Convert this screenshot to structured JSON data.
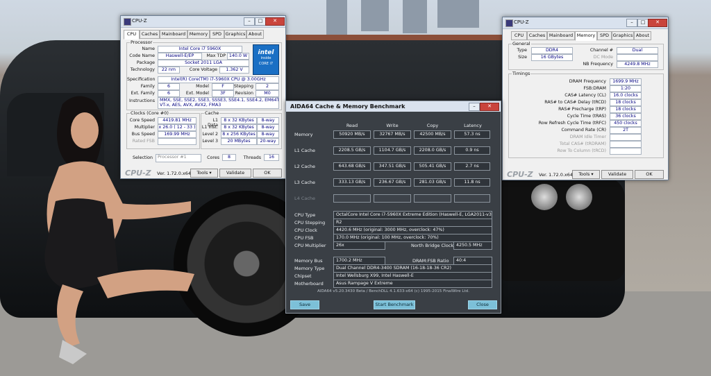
{
  "cpuz_left": {
    "title": "CPU-Z",
    "tabs": [
      "CPU",
      "Caches",
      "Mainboard",
      "Memory",
      "SPD",
      "Graphics",
      "About"
    ],
    "processor": {
      "group": "Processor",
      "name_label": "Name",
      "name": "Intel Core i7 5960X",
      "codename_label": "Code Name",
      "codename": "Haswell-E/EP",
      "tdp_label": "Max TDP",
      "tdp": "140.0 W",
      "package_label": "Package",
      "package": "Socket 2011 LGA",
      "technology_label": "Technology",
      "technology": "22 nm",
      "voltage_label": "Core Voltage",
      "voltage": "1.362 V",
      "spec_label": "Specification",
      "spec": "Intel(R) Core(TM) i7-5960X CPU @ 3.00GHz",
      "family_label": "Family",
      "family": "6",
      "model_label": "Model",
      "model": "F",
      "stepping_label": "Stepping",
      "stepping": "2",
      "extfamily_label": "Ext. Family",
      "extfamily": "6",
      "extmodel_label": "Ext. Model",
      "extmodel": "3F",
      "revision_label": "Revision",
      "revision": "M0",
      "instructions_label": "Instructions",
      "instructions_1": "MMX, SSE, SSE2, SSE3, SSSE3, SSE4.1, SSE4.2, EM64T,",
      "instructions_2": "VT-x, AES, AVX, AVX2, FMA3",
      "logo_1": "intel",
      "logo_2": "inside",
      "logo_3": "CORE i7"
    },
    "clocks": {
      "group": "Clocks (Core #0)",
      "core_speed_label": "Core Speed",
      "core_speed": "4419.81 MHz",
      "multiplier_label": "Multiplier",
      "multiplier": "x 26.0 ( 12 - 33 )",
      "bus_speed_label": "Bus Speed",
      "bus_speed": "169.99 MHz",
      "rated_fsb_label": "Rated FSB",
      "rated_fsb": ""
    },
    "cache": {
      "group": "Cache",
      "l1d_label": "L1 Data",
      "l1d": "8 x 32 KBytes",
      "l1d_way": "8-way",
      "l1i_label": "L1 Inst.",
      "l1i": "8 x 32 KBytes",
      "l1i_way": "8-way",
      "l2_label": "Level 2",
      "l2": "8 x 256 KBytes",
      "l2_way": "8-way",
      "l3_label": "Level 3",
      "l3": "20 MBytes",
      "l3_way": "20-way"
    },
    "selection_label": "Selection",
    "selection": "Processor #1",
    "cores_label": "Cores",
    "cores": "8",
    "threads_label": "Threads",
    "threads": "16",
    "brand": "CPU-Z",
    "version": "Ver. 1.72.0.x64",
    "tools": "Tools",
    "validate": "Validate",
    "ok": "OK"
  },
  "cpuz_right": {
    "title": "CPU-Z",
    "tabs": [
      "CPU",
      "Caches",
      "Mainboard",
      "Memory",
      "SPD",
      "Graphics",
      "About"
    ],
    "general": {
      "group": "General",
      "type_label": "Type",
      "type": "DDR4",
      "channel_label": "Channel #",
      "channel": "Dual",
      "size_label": "Size",
      "size": "16 GBytes",
      "dcmode_label": "DC Mode",
      "dcmode": "",
      "nbfreq_label": "NB Frequency",
      "nbfreq": "4249.8 MHz"
    },
    "timings": {
      "group": "Timings",
      "rows": [
        {
          "label": "DRAM Frequency",
          "value": "1699.9 MHz",
          "dim": false
        },
        {
          "label": "FSB:DRAM",
          "value": "1:20",
          "dim": false
        },
        {
          "label": "CAS# Latency (CL)",
          "value": "16.0 clocks",
          "dim": false
        },
        {
          "label": "RAS# to CAS# Delay (tRCD)",
          "value": "18 clocks",
          "dim": false
        },
        {
          "label": "RAS# Precharge (tRP)",
          "value": "18 clocks",
          "dim": false
        },
        {
          "label": "Cycle Time (tRAS)",
          "value": "36 clocks",
          "dim": false
        },
        {
          "label": "Row Refresh Cycle Time (tRFC)",
          "value": "450 clocks",
          "dim": false
        },
        {
          "label": "Command Rate (CR)",
          "value": "2T",
          "dim": false
        },
        {
          "label": "DRAM Idle Timer",
          "value": "",
          "dim": true
        },
        {
          "label": "Total CAS# (tRDRAM)",
          "value": "",
          "dim": true
        },
        {
          "label": "Row To Column (tRCD)",
          "value": "",
          "dim": true
        }
      ]
    },
    "brand": "CPU-Z",
    "version": "Ver. 1.72.0.x64",
    "tools": "Tools",
    "validate": "Validate",
    "ok": "OK"
  },
  "aida": {
    "title": "AIDA64 Cache & Memory Benchmark",
    "columns": [
      "Read",
      "Write",
      "Copy",
      "Latency"
    ],
    "rows": [
      {
        "label": "Memory",
        "read": "50920 MB/s",
        "write": "32767 MB/s",
        "copy": "42500 MB/s",
        "latency": "57.3 ns"
      },
      {
        "label": "L1 Cache",
        "read": "2208.5 GB/s",
        "write": "1104.7 GB/s",
        "copy": "2208.0 GB/s",
        "latency": "0.9 ns"
      },
      {
        "label": "L2 Cache",
        "read": "643.68 GB/s",
        "write": "347.51 GB/s",
        "copy": "505.41 GB/s",
        "latency": "2.7 ns"
      },
      {
        "label": "L3 Cache",
        "read": "333.13 GB/s",
        "write": "236.67 GB/s",
        "copy": "281.03 GB/s",
        "latency": "11.8 ns"
      },
      {
        "label": "L4 Cache",
        "read": "",
        "write": "",
        "copy": "",
        "latency": ""
      }
    ],
    "info": {
      "cpu_type_label": "CPU Type",
      "cpu_type": "OctalCore Intel Core i7-5960X Extreme Edition  (Haswell-E, LGA2011-v3)",
      "cpu_stepping_label": "CPU Stepping",
      "cpu_stepping": "R2",
      "cpu_clock_label": "CPU Clock",
      "cpu_clock": "4420.6 MHz  (original: 3000 MHz, overclock: 47%)",
      "cpu_fsb_label": "CPU FSB",
      "cpu_fsb": "170.0 MHz  (original: 100 MHz, overclock: 70%)",
      "cpu_mult_label": "CPU Multiplier",
      "cpu_mult": "26x",
      "nb_clock_label": "North Bridge Clock",
      "nb_clock": "4250.5 MHz",
      "mem_bus_label": "Memory Bus",
      "mem_bus": "1700.2 MHz",
      "dram_fsb_label": "DRAM:FSB Ratio",
      "dram_fsb": "40:4",
      "mem_type_label": "Memory Type",
      "mem_type": "Dual Channel DDR4-3400 SDRAM  (16-18-18-36 CR2)",
      "chipset_label": "Chipset",
      "chipset": "Intel Wellsburg X99, Intel Haswell-E",
      "motherboard_label": "Motherboard",
      "motherboard": "Asus Rampage V Extreme"
    },
    "footer": "AIDA64 v5.20.3430 Beta / BenchDLL 4.1.633-x64  (c) 1995-2015 FinalWire Ltd.",
    "save": "Save",
    "start": "Start Benchmark",
    "close": "Close"
  }
}
